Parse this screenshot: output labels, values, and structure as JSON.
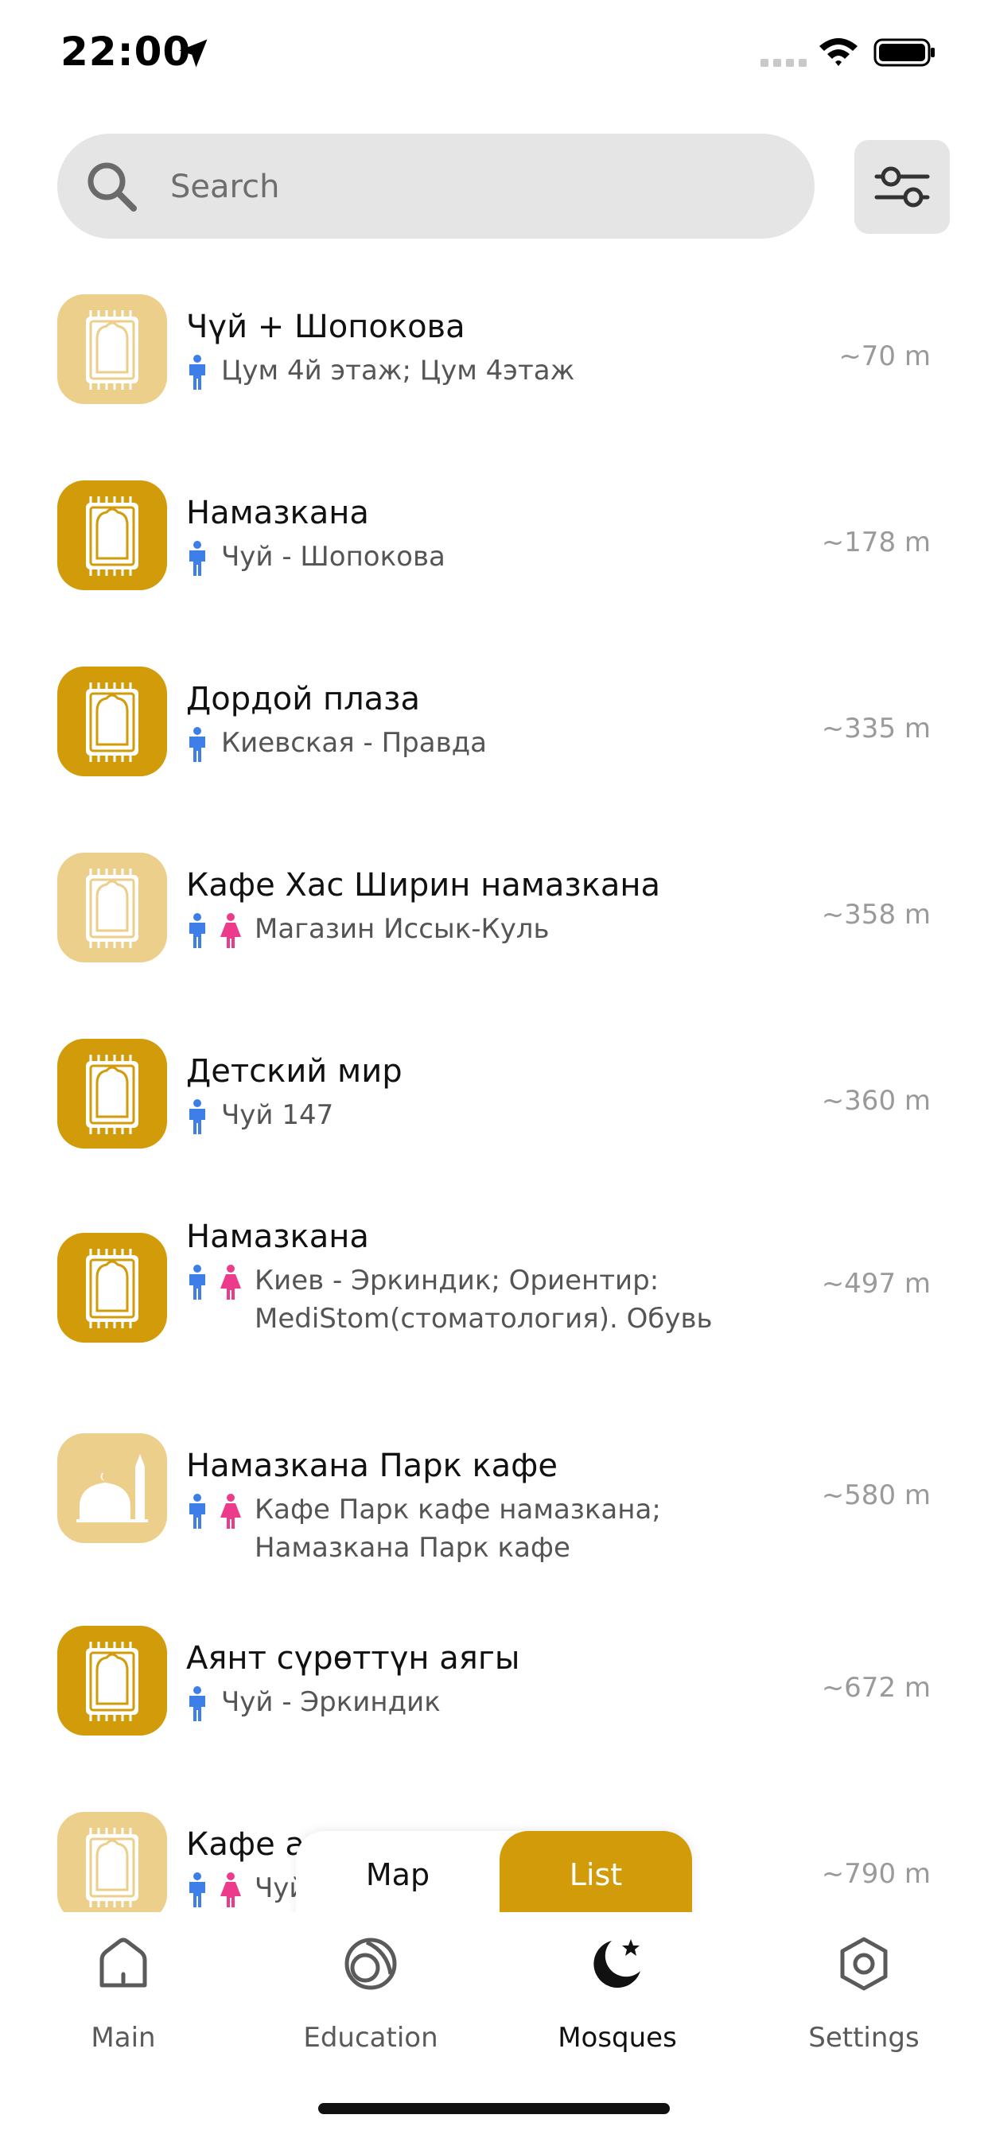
{
  "status": {
    "time": "22:00"
  },
  "search": {
    "placeholder": "Search"
  },
  "items": [
    {
      "title": "Чүй + Шопокова",
      "subtitle": "Цум 4й этаж; Цум 4этаж",
      "distance": "~70 m",
      "thumb": "light",
      "icon": "prayer-rug-icon",
      "men": true,
      "women": false
    },
    {
      "title": "Намазкана",
      "subtitle": "Чуй - Шопокова",
      "distance": "~178 m",
      "thumb": "dark",
      "icon": "prayer-rug-icon",
      "men": true,
      "women": false
    },
    {
      "title": "Дордой плаза",
      "subtitle": "Киевская - Правда",
      "distance": "~335 m",
      "thumb": "dark",
      "icon": "prayer-rug-icon",
      "men": true,
      "women": false
    },
    {
      "title": "Кафе Хас Ширин намазкана",
      "subtitle": "Магазин Иссык-Куль",
      "distance": "~358 m",
      "thumb": "light",
      "icon": "prayer-rug-icon",
      "men": true,
      "women": true
    },
    {
      "title": "Детский мир",
      "subtitle": "Чуй 147",
      "distance": "~360 m",
      "thumb": "dark",
      "icon": "prayer-rug-icon",
      "men": true,
      "women": false
    },
    {
      "title": "Намазкана",
      "subtitle": "Киев - Эркиндик; Ориентир: MediStom(стоматология). Обувь",
      "distance": "~497 m",
      "thumb": "dark",
      "icon": "prayer-rug-icon",
      "men": true,
      "women": true
    },
    {
      "title": "Намазкана Парк кафе",
      "subtitle": "Кафе Парк кафе намазкана; Намазкана Парк кафе",
      "distance": "~580 m",
      "thumb": "light",
      "icon": "mosque-icon",
      "men": true,
      "women": true
    },
    {
      "title": "Аянт сүрөттүн аягы",
      "subtitle": "Чуй - Эркиндик",
      "distance": "~672 m",
      "thumb": "dark",
      "icon": "prayer-rug-icon",
      "men": true,
      "women": false
    },
    {
      "title": "Кафе а",
      "subtitle": "Чуй",
      "distance": "~790 m",
      "thumb": "light",
      "icon": "prayer-rug-icon",
      "men": true,
      "women": true
    }
  ],
  "toggle": {
    "map": "Map",
    "list": "List",
    "active": "list"
  },
  "tabs": [
    {
      "label": "Main",
      "icon": "house-icon"
    },
    {
      "label": "Education",
      "icon": "education-icon"
    },
    {
      "label": "Mosques",
      "icon": "moon-star-icon",
      "active": true
    },
    {
      "label": "Settings",
      "icon": "gear-icon"
    }
  ],
  "colors": {
    "accent": "#d29b0a",
    "accent_light": "#ebcf8a",
    "men_icon": "#3d7ee8",
    "women_icon": "#ec3b8a",
    "search_bg": "#e5e5e5"
  }
}
